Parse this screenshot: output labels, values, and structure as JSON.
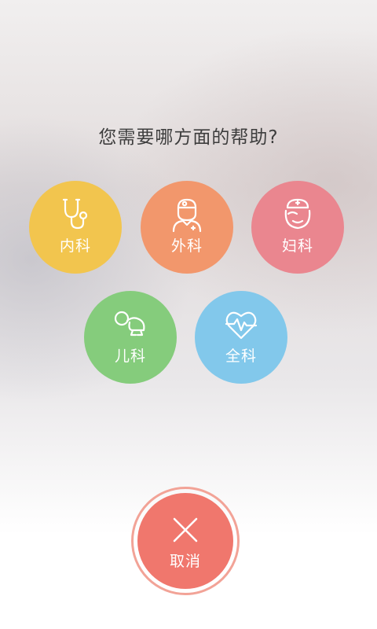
{
  "title": "您需要哪方面的帮助?",
  "departments": [
    {
      "label": "内科",
      "icon": "stethoscope-icon",
      "color": "#f2c54e"
    },
    {
      "label": "外科",
      "icon": "surgeon-icon",
      "color": "#f2976c"
    },
    {
      "label": "妇科",
      "icon": "nurse-icon",
      "color": "#ea868f"
    },
    {
      "label": "儿科",
      "icon": "baby-icon",
      "color": "#85cc7c"
    },
    {
      "label": "全科",
      "icon": "heart-pulse-icon",
      "color": "#82c8eb"
    }
  ],
  "cancel": {
    "label": "取消",
    "icon": "close-icon",
    "color": "#f0776d",
    "ring_color": "#f2a397"
  }
}
